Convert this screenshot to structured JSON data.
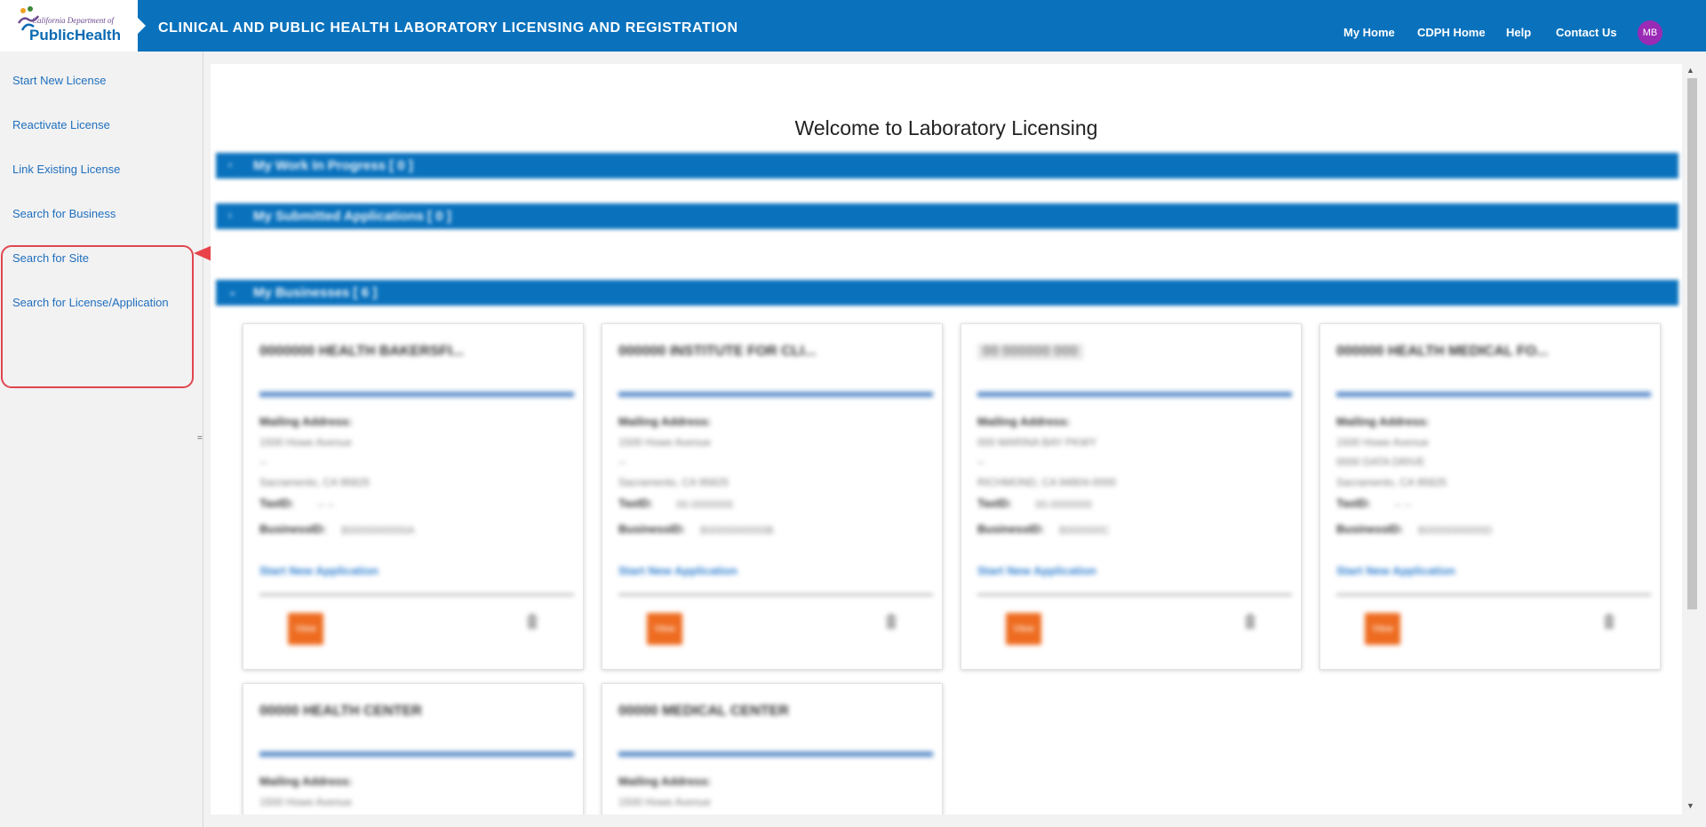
{
  "header": {
    "logo_line1": "California Department of",
    "logo_line2": "PublicHealth",
    "title": "CLINICAL AND PUBLIC HEALTH LABORATORY LICENSING AND REGISTRATION",
    "nav": [
      "My Home",
      "CDPH Home",
      "Help",
      "Contact Us"
    ],
    "avatar_initials": "MB"
  },
  "sidebar": {
    "items": [
      "Start New License",
      "Reactivate License",
      "Link Existing License",
      "Search for Business",
      "Search for Site",
      "Search for License/Application"
    ],
    "grip": "="
  },
  "main": {
    "welcome": "Welcome to Laboratory Licensing",
    "sections": [
      "My Work In Progress [ 0 ]",
      "My Submitted Applications [ 0 ]",
      "My Businesses [ 6 ]"
    ],
    "cards": [
      {
        "title": "0000000 HEALTH BAKERSFI...",
        "mailing_label": "Mailing Address:",
        "addr1": "1500 Howe Avenue",
        "addr2": "--",
        "addr3": "Sacramento, CA 95825",
        "taxid_label": "TaxID:",
        "taxid": "-- --",
        "business_label": "BusinessID:",
        "business": "B0000000000A",
        "link": "Start New Application",
        "button": "View"
      },
      {
        "title": "000000 INSTITUTE FOR CLI...",
        "mailing_label": "Mailing Address:",
        "addr1": "1500 Howe Avenue",
        "addr2": "--",
        "addr3": "Sacramento, CA 95825",
        "taxid_label": "TaxID:",
        "taxid": "00-0000000",
        "business_label": "BusinessID:",
        "business": "B0000000000B",
        "link": "Start New Application",
        "button": "View"
      },
      {
        "title": "00 000000 000",
        "mailing_label": "Mailing Address:",
        "addr1": "000 MARINA BAY PKWY",
        "addr2": "--",
        "addr3": "RICHMOND, CA 94804-0000",
        "taxid_label": "TaxID:",
        "taxid": "00-0000000",
        "business_label": "BusinessID:",
        "business": "B000000C",
        "link": "Start New Application",
        "button": "View"
      },
      {
        "title": "000000 HEALTH MEDICAL FO...",
        "mailing_label": "Mailing Address:",
        "addr1": "1500 Howe Avenue",
        "addr2": "0000 DATA DRIVE",
        "addr3": "Sacramento, CA 95825",
        "taxid_label": "TaxID:",
        "taxid": "-- --",
        "business_label": "BusinessID:",
        "business": "B0000000000D",
        "link": "Start New Application",
        "button": "View"
      },
      {
        "title": "00000 HEALTH CENTER",
        "mailing_label": "Mailing Address:",
        "addr1": "1500 Howe Avenue"
      },
      {
        "title": "00000 MEDICAL CENTER",
        "mailing_label": "Mailing Address:",
        "addr1": "1500 Howe Avenue"
      }
    ]
  },
  "colors": {
    "brand_blue": "#0a72bd",
    "link_blue": "#1f6fbf",
    "action_orange": "#ee6b1f",
    "highlight_red": "#e0464f",
    "avatar_purple": "#9a2bb5"
  }
}
